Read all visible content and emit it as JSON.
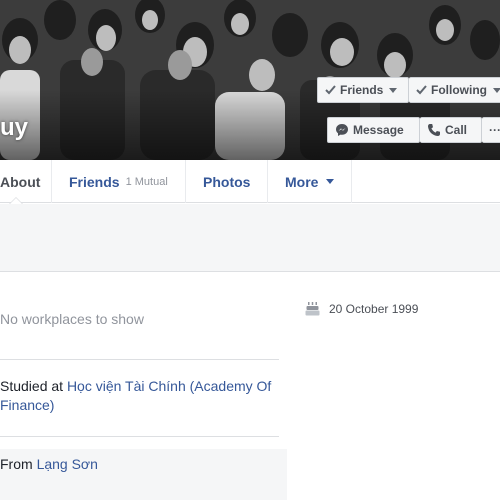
{
  "cover": {
    "name_partial": "uy",
    "buttons": {
      "friends": "Friends",
      "following": "Following",
      "message": "Message",
      "call": "Call",
      "more": "···"
    }
  },
  "tabs": {
    "about": "About",
    "friends": "Friends",
    "friends_mutual": "1 Mutual",
    "photos": "Photos",
    "more": "More"
  },
  "about": {
    "work": "No workplaces to show",
    "education_prefix": "Studied at ",
    "education_link": "Học viện Tài Chính (Academy Of Finance)",
    "home_prefix": "From ",
    "home_link": "Lạng Sơn",
    "birthday": "20 October 1999"
  },
  "colors": {
    "link": "#365899",
    "muted": "#90949c",
    "border": "#dddfe2"
  },
  "icons": {
    "check": "check-icon",
    "messenger": "messenger-icon",
    "phone": "phone-icon",
    "cake": "birthday-cake-icon"
  }
}
